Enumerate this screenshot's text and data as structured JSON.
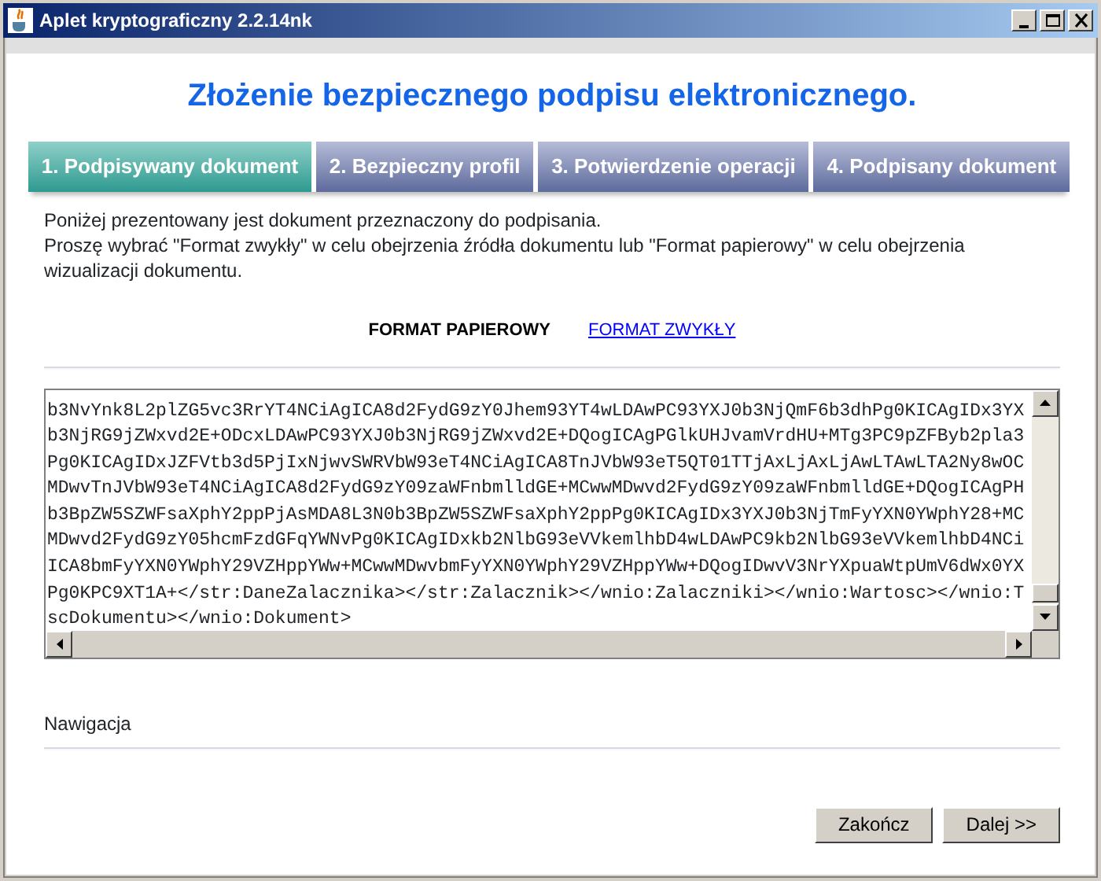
{
  "window": {
    "title": "Aplet kryptograficzny 2.2.14nk"
  },
  "heading": "Złożenie bezpiecznego podpisu elektronicznego.",
  "steps": [
    {
      "label": "1. Podpisywany dokument",
      "selected": true
    },
    {
      "label": "2. Bezpieczny profil",
      "selected": false
    },
    {
      "label": "3. Potwierdzenie operacji",
      "selected": false
    },
    {
      "label": "4. Podpisany dokument",
      "selected": false
    }
  ],
  "description": [
    "Poniżej prezentowany jest dokument przeznaczony do podpisania.",
    "Proszę wybrać \"Format zwykły\" w celu obejrzenia źródła dokumentu lub \"Format papierowy\" w celu obejrzenia wizualizacji dokumentu."
  ],
  "formats": [
    {
      "label": "FORMAT PAPIEROWY",
      "selected": true
    },
    {
      "label": "FORMAT ZWYKŁY",
      "selected": false
    }
  ],
  "document_lines": [
    "b3NvYnk8L2plZG5vc3RrYT4NCiAgICA8d2FydG9zY0Jhem93YT4wLDAwPC93YXJ0b3NjQmF6b3dhPg0KICAgIDx3YX",
    "b3NjRG9jZWxvd2E+ODcxLDAwPC93YXJ0b3NjRG9jZWxvd2E+DQogICAgPGlkUHJvamVrdHU+MTg3PC9pZFByb2pla3",
    "Pg0KICAgIDxJZFVtb3d5PjIxNjwvSWRVbW93eT4NCiAgICA8TnJVbW93eT5QT01TTjAxLjAxLjAwLTAwLTA2Ny8wOC",
    "MDwvTnJVbW93eT4NCiAgICA8d2FydG9zY09zaWFnbmlldGE+MCwwMDwvd2FydG9zY09zaWFnbmlldGE+DQogICAgPH",
    "b3BpZW5SZWFsaXphY2ppPjAsMDA8L3N0b3BpZW5SZWFsaXphY2ppPg0KICAgIDx3YXJ0b3NjTmFyYXN0YWphY28+MC",
    "MDwvd2FydG9zY05hcmFzdGFqYWNvPg0KICAgIDxkb2NlbG93eVVkemlhbD4wLDAwPC9kb2NlbG93eVVkemlhbD4NCi",
    "ICA8bmFyYXN0YWphY29VZHppYWw+MCwwMDwvbmFyYXN0YWphY29VZHppYWw+DQogIDwvV3NrYXpuaWtpUmV6dWx0YX",
    "Pg0KPC9XT1A+</str:DaneZalacznika></str:Zalacznik></wnio:Zalaczniki></wnio:Wartosc></wnio:T",
    "scDokumentu></wnio:Dokument>"
  ],
  "navigation_label": "Nawigacja",
  "buttons": [
    "Zakończ",
    "Dalej >>"
  ]
}
